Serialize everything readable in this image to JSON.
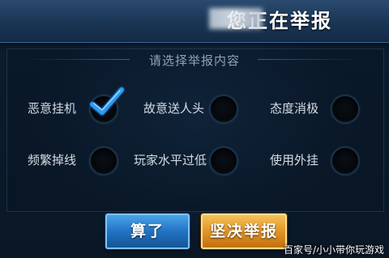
{
  "dialog": {
    "title": "您正在举报",
    "subtitle": "请选择举报内容"
  },
  "options": [
    {
      "label": "恶意挂机",
      "selected": true
    },
    {
      "label": "故意送人头",
      "selected": false
    },
    {
      "label": "态度消极",
      "selected": false
    },
    {
      "label": "频繁掉线",
      "selected": false
    },
    {
      "label": "玩家水平过低",
      "selected": false
    },
    {
      "label": "使用外挂",
      "selected": false
    }
  ],
  "buttons": {
    "cancel": "算了",
    "confirm": "坚决举报"
  },
  "watermark": "百家号/小小带你玩游戏",
  "colors": {
    "background": "#0b1a2b",
    "check": "#2b9bf0",
    "cancel_button": "#2273c4",
    "confirm_button": "#e29526"
  }
}
